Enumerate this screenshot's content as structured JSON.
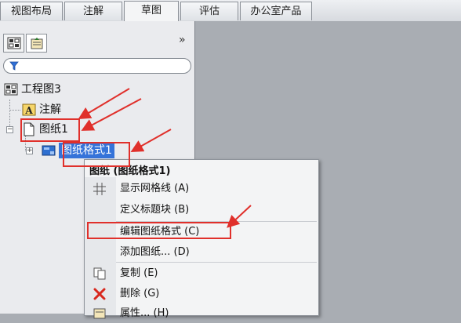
{
  "tabs": [
    {
      "label": "视图布局",
      "active": false
    },
    {
      "label": "注解",
      "active": false
    },
    {
      "label": "草图",
      "active": true
    },
    {
      "label": "评估",
      "active": false
    },
    {
      "label": "办公室产品",
      "active": false
    }
  ],
  "panel": {
    "collapse_glyph": "»"
  },
  "tree": {
    "root_label": "工程图3",
    "annotation_label": "注解",
    "sheet_label": "图纸1",
    "sheet_format_label": "图纸格式1"
  },
  "context_menu": {
    "title": "图纸 (图纸格式1)",
    "items": [
      {
        "label": "显示网格线 (A)",
        "icon": "grid-icon"
      },
      {
        "label": "定义标题块 (B)",
        "icon": ""
      },
      {
        "label": "编辑图纸格式 (C)",
        "icon": ""
      },
      {
        "label": "添加图纸... (D)",
        "icon": ""
      },
      {
        "label": "复制 (E)",
        "icon": "copy-icon"
      },
      {
        "label": "删除 (G)",
        "icon": "delete-icon"
      },
      {
        "label": "属性... (H)",
        "icon": "properties-icon"
      }
    ]
  },
  "colors": {
    "annotation_red": "#e0302b",
    "selection_blue": "#3573d9"
  }
}
